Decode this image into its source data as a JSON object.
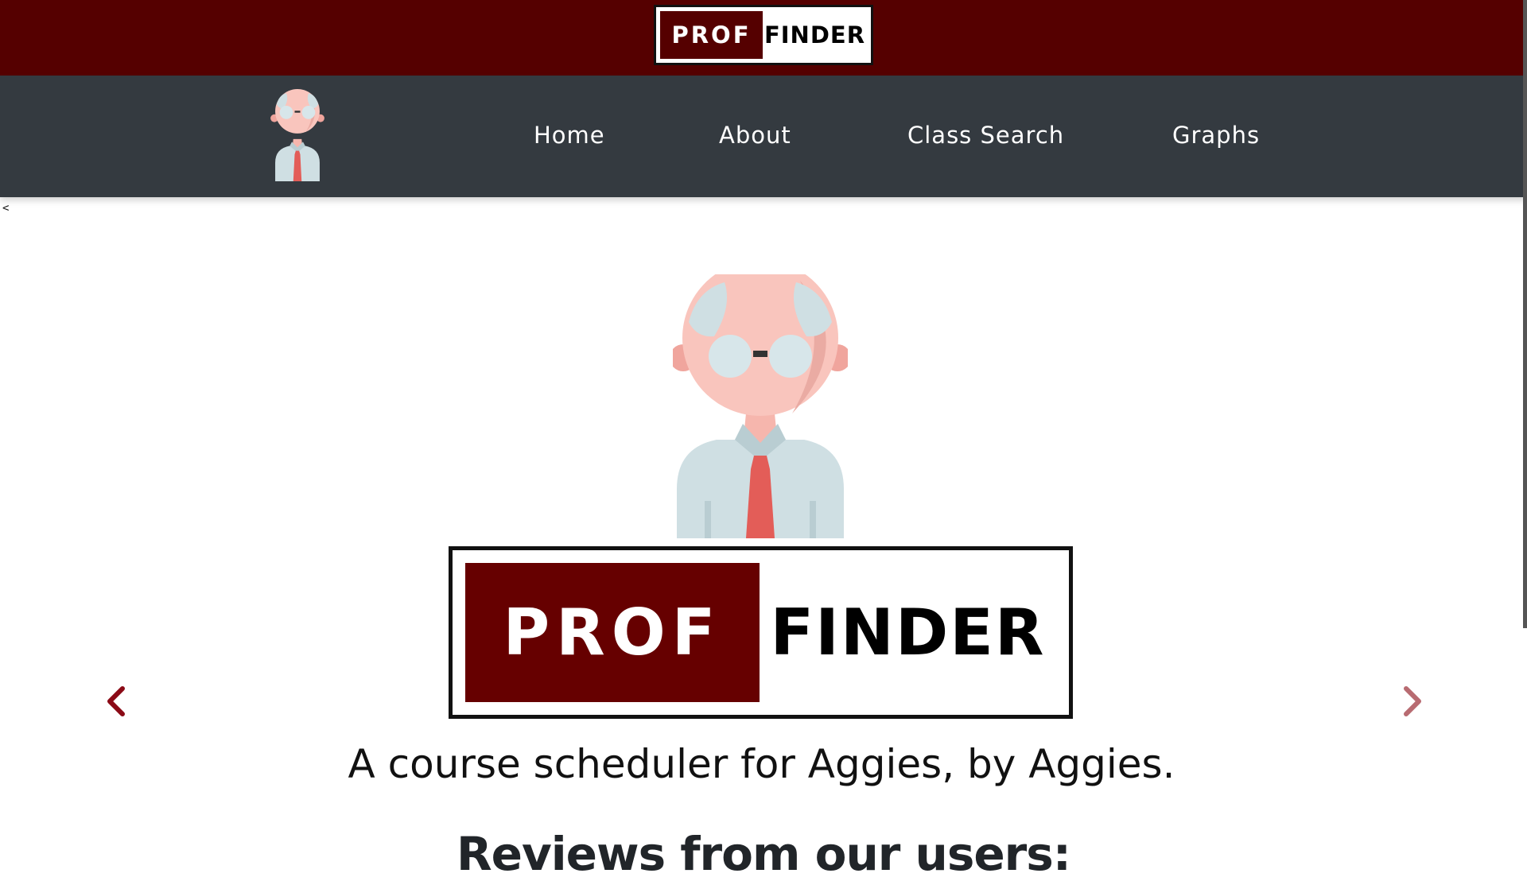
{
  "brand": {
    "left_text": "PROF",
    "right_text": "FINDER",
    "maroon": "#550000"
  },
  "nav": {
    "avatar_icon": "professor-avatar-icon",
    "items": [
      {
        "label": "Home"
      },
      {
        "label": "About"
      },
      {
        "label": "Class Search"
      },
      {
        "label": "Graphs"
      }
    ],
    "background": "#343a40"
  },
  "stray_text": "<",
  "hero": {
    "avatar_icon": "professor-avatar-icon",
    "logo_left": "PROF",
    "logo_right": "FINDER",
    "tagline": "A course scheduler for Aggies, by Aggies.",
    "prev_icon": "chevron-left-icon",
    "next_icon": "chevron-right-icon"
  },
  "reviews": {
    "heading": "Reviews from our users:"
  }
}
